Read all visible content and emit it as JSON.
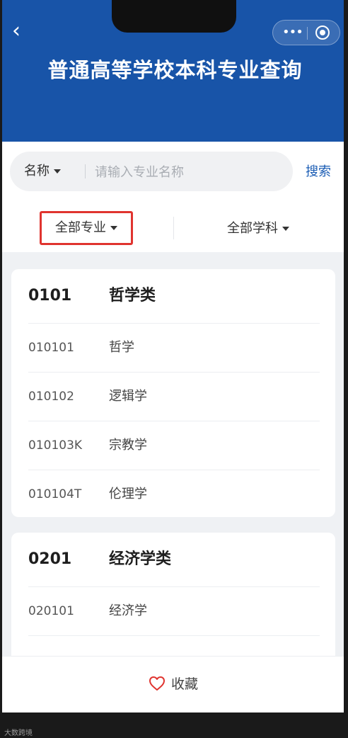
{
  "header": {
    "title": "普通高等学校本科专业查询",
    "back_icon": "chevron-left-icon",
    "more_icon": "more-dots-icon",
    "close_icon": "target-circle-icon",
    "color": "#1854a8"
  },
  "search": {
    "field_label": "名称",
    "placeholder": "请输入专业名称",
    "value": "",
    "button": "搜索"
  },
  "filters": {
    "category": "全部专业",
    "subject": "全部学科",
    "highlight_color": "#e0342f"
  },
  "groups": [
    {
      "code": "0101",
      "name": "哲学类",
      "items": [
        {
          "code": "010101",
          "name": "哲学"
        },
        {
          "code": "010102",
          "name": "逻辑学"
        },
        {
          "code": "010103K",
          "name": "宗教学"
        },
        {
          "code": "010104T",
          "name": "伦理学"
        }
      ]
    },
    {
      "code": "0201",
      "name": "经济学类",
      "items": [
        {
          "code": "020101",
          "name": "经济学"
        }
      ]
    }
  ],
  "footer": {
    "favorite_label": "收藏",
    "favorite_icon": "heart-outline-icon"
  },
  "watermark": "大数跨境"
}
